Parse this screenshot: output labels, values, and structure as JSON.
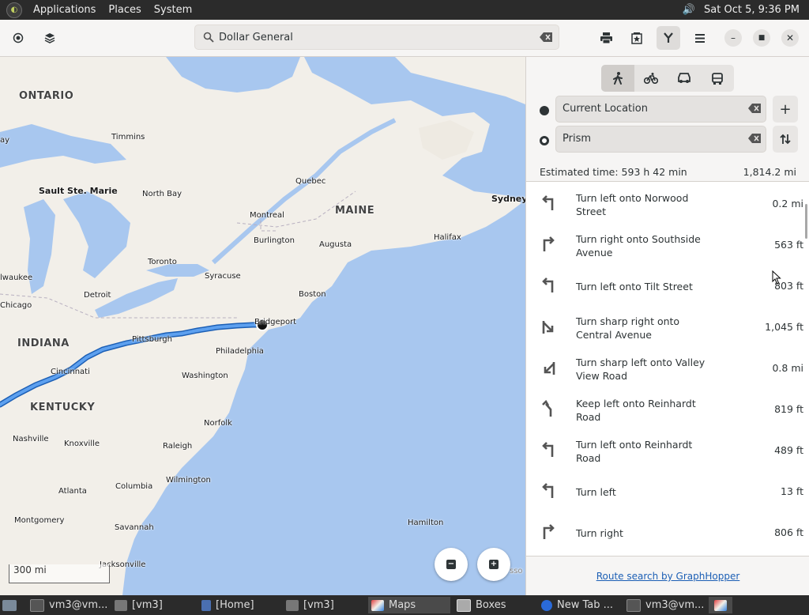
{
  "top_panel": {
    "menus": [
      "Applications",
      "Places",
      "System"
    ],
    "clock": "Sat Oct  5,  9:36 PM"
  },
  "header": {
    "search_value": "Dollar General"
  },
  "map": {
    "labels": {
      "ontario": "ONTARIO",
      "timmins": "Timmins",
      "ay": "ay",
      "sault": "Sault Ste. Marie",
      "north_bay": "North Bay",
      "quebec": "Quebec",
      "maine": "MAINE",
      "sydney": "Sydney",
      "montreal": "Montreal",
      "burlington": "Burlington",
      "augusta": "Augusta",
      "halifax": "Halifax",
      "toronto": "Toronto",
      "waukee": "lwaukee",
      "syracuse": "Syracuse",
      "chicago": "Chicago",
      "detroit": "Detroit",
      "boston": "Boston",
      "bridgeport": "Bridgeport",
      "indiana": "INDIANA",
      "pittsburgh": "Pittsburgh",
      "philadelphia": "Philadelphia",
      "cincinnati": "Cincinnati",
      "washington": "Washington",
      "kentucky": "KENTUCKY",
      "norfolk": "Norfolk",
      "nashville": "Nashville",
      "knoxville": "Knoxville",
      "raleigh": "Raleigh",
      "wilmington": "Wilmington",
      "atlanta": "Atlanta",
      "columbia": "Columbia",
      "montgomery": "Montgomery",
      "savannah": "Savannah",
      "hamilton": "Hamilton",
      "jacksonville": "Jacksonville",
      "sso": "sso"
    },
    "scale": "300 mi"
  },
  "sidebar": {
    "modes": [
      "walk",
      "bike",
      "car",
      "transit"
    ],
    "from": "Current Location",
    "to": "Prism",
    "estimate": "Estimated time: 593 h 42 min",
    "distance": "1,814.2 mi",
    "steps": [
      {
        "text": "Turn left onto Norwood Street",
        "dist": "0.2 mi",
        "icon": "turn-left-icon"
      },
      {
        "text": "Turn right onto Southside Avenue",
        "dist": "563 ft",
        "icon": "turn-right-icon"
      },
      {
        "text": "Turn left onto Tilt Street",
        "dist": "803 ft",
        "icon": "turn-left-icon"
      },
      {
        "text": "Turn sharp right onto Central Avenue",
        "dist": "1,045 ft",
        "icon": "sharp-right-icon"
      },
      {
        "text": "Turn sharp left onto Valley View Road",
        "dist": "0.8 mi",
        "icon": "sharp-left-icon"
      },
      {
        "text": "Keep left onto Reinhardt Road",
        "dist": "819 ft",
        "icon": "keep-left-icon"
      },
      {
        "text": "Turn left onto Reinhardt Road",
        "dist": "489 ft",
        "icon": "turn-left-icon"
      },
      {
        "text": "Turn left",
        "dist": "13 ft",
        "icon": "turn-left-icon"
      },
      {
        "text": "Turn right",
        "dist": "806 ft",
        "icon": "turn-right-icon"
      }
    ],
    "footer_link": "Route search by GraphHopper"
  },
  "taskbar": {
    "tasks": [
      "vm3@vm...",
      "[vm3]",
      "[Home]",
      "[vm3]",
      "Maps",
      "Boxes",
      "New Tab ...",
      "vm3@vm..."
    ]
  },
  "colors": {
    "route": "#3584e4",
    "water": "#a8c7ef",
    "land": "#f2efe9",
    "panel": "#2b2b2b"
  }
}
